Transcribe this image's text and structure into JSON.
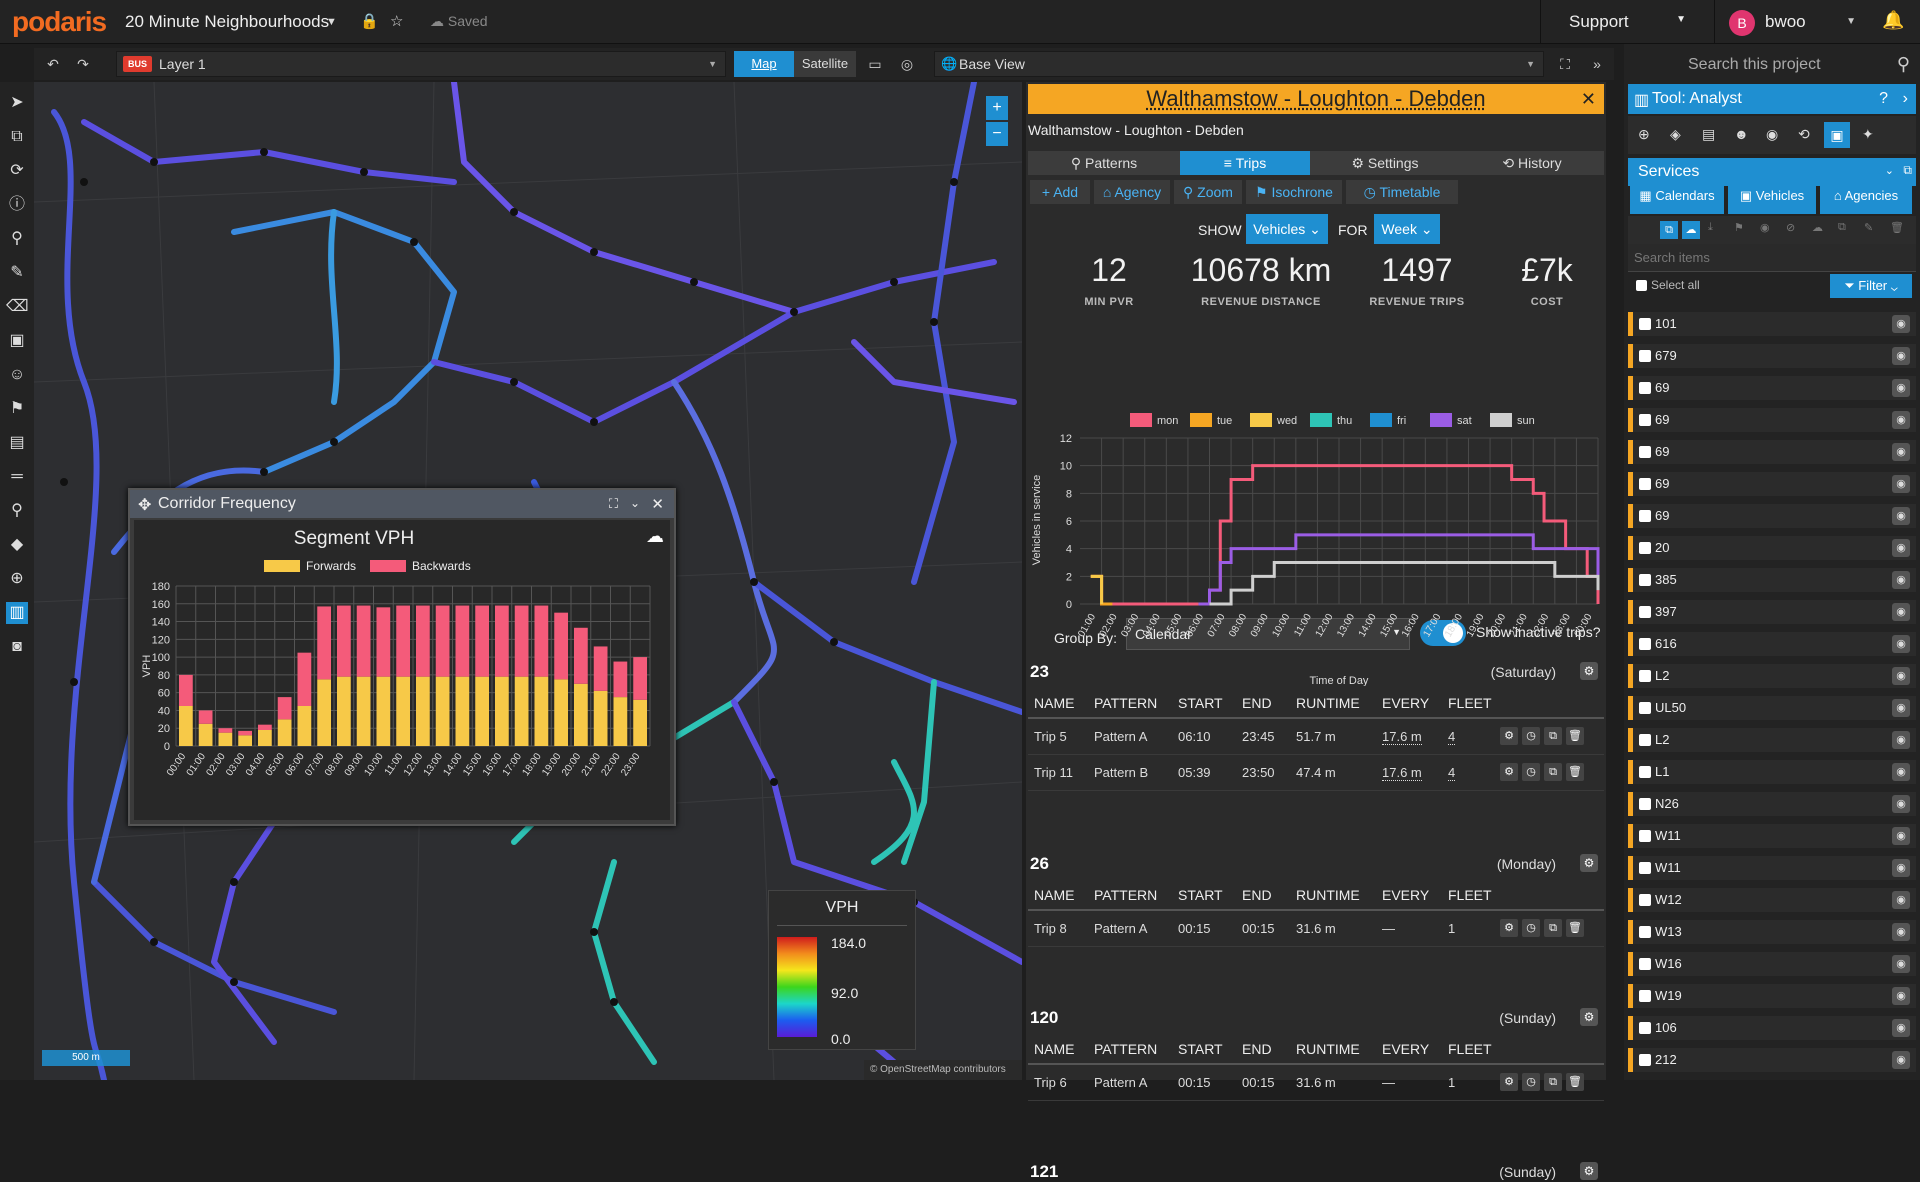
{
  "app": {
    "logo": "podaris",
    "project_title": "20 Minute Neighbourhoods",
    "saved": "Saved",
    "support": "Support",
    "user_initial": "B",
    "user_name": "bwoo"
  },
  "toolbar2": {
    "layer_badge": "BUS",
    "layer_name": "Layer 1",
    "map_btn": "Map",
    "satellite_btn": "Satellite",
    "base_view": "Base View"
  },
  "map": {
    "scale": "500 m",
    "attribution": "© OpenStreetMap contributors"
  },
  "corridor": {
    "window_title": "Corridor Frequency",
    "chart_data": {
      "type": "bar",
      "title": "Segment VPH",
      "ylabel": "VPH",
      "ylim": [
        0,
        180
      ],
      "yticks": [
        0,
        20,
        40,
        60,
        80,
        100,
        120,
        140,
        160,
        180
      ],
      "categories": [
        "00:00",
        "01:00",
        "02:00",
        "03:00",
        "04:00",
        "05:00",
        "06:00",
        "07:00",
        "08:00",
        "09:00",
        "10:00",
        "11:00",
        "12:00",
        "13:00",
        "14:00",
        "15:00",
        "16:00",
        "17:00",
        "18:00",
        "19:00",
        "20:00",
        "21:00",
        "22:00",
        "23:00"
      ],
      "series": [
        {
          "name": "Forwards",
          "color": "#f7c948",
          "values": [
            45,
            25,
            15,
            12,
            18,
            30,
            45,
            75,
            78,
            78,
            78,
            78,
            78,
            78,
            78,
            78,
            78,
            78,
            78,
            75,
            70,
            62,
            55,
            52
          ]
        },
        {
          "name": "Backwards",
          "color": "#f45b7a",
          "values": [
            35,
            15,
            5,
            5,
            6,
            25,
            60,
            82,
            80,
            80,
            78,
            80,
            80,
            80,
            80,
            80,
            80,
            80,
            80,
            75,
            63,
            50,
            40,
            48
          ]
        }
      ]
    }
  },
  "vph_legend": {
    "title": "VPH",
    "max": "184.0",
    "mid": "92.0",
    "min": "0.0"
  },
  "route": {
    "title": "Walthamstow - Loughton - Debden",
    "subtitle": "Walthamstow - Loughton - Debden",
    "tabs": [
      "Patterns",
      "Trips",
      "Settings",
      "History"
    ],
    "actions": [
      "Add",
      "Agency",
      "Zoom",
      "Isochrone",
      "Timetable"
    ],
    "show_label": "SHOW",
    "show_value": "Vehicles",
    "for_label": "FOR",
    "for_value": "Week",
    "stats": [
      {
        "value": "12",
        "label": "MIN PVR"
      },
      {
        "value": "10678 km",
        "label": "REVENUE DISTANCE"
      },
      {
        "value": "1497",
        "label": "REVENUE TRIPS"
      },
      {
        "value": "£7k",
        "label": "COST"
      }
    ],
    "chart_data": {
      "type": "line",
      "ylabel": "Vehicles in service",
      "xlabel": "Time of Day",
      "ylim": [
        0,
        12
      ],
      "yticks": [
        0,
        2,
        4,
        6,
        8,
        10,
        12
      ],
      "xticks": [
        "01:00",
        "02:00",
        "03:00",
        "04:00",
        "05:00",
        "06:00",
        "07:00",
        "08:00",
        "09:00",
        "10:00",
        "11:00",
        "12:00",
        "13:00",
        "14:00",
        "15:00",
        "16:00",
        "17:00",
        "18:00",
        "19:00",
        "20:00",
        "21:00",
        "22:00",
        "23:00",
        "00:00"
      ],
      "series": [
        {
          "name": "mon",
          "color": "#f45b7a",
          "x": [
            0.5,
            1,
            1.5,
            5.5,
            6,
            6.5,
            7,
            8,
            9,
            10,
            11,
            12,
            13,
            14,
            15,
            16,
            17,
            18,
            19,
            20,
            21,
            21.5,
            22,
            22.5,
            23,
            23.5,
            24
          ],
          "y": [
            2,
            0,
            0,
            0,
            1,
            6,
            9,
            10,
            10,
            10,
            10,
            10,
            10,
            10,
            10,
            10,
            10,
            10,
            10,
            9,
            8,
            6,
            6,
            4,
            4,
            2,
            0
          ]
        },
        {
          "name": "tue",
          "color": "#f5a623",
          "x": [
            0.5,
            1,
            1.5
          ],
          "y": [
            2,
            0,
            0
          ]
        },
        {
          "name": "wed",
          "color": "#f7c948",
          "x": [
            0.5,
            1
          ],
          "y": [
            2,
            0
          ]
        },
        {
          "name": "thu",
          "color": "#2ec4b6",
          "x": [
            5.5,
            6
          ],
          "y": [
            0,
            0
          ]
        },
        {
          "name": "fri",
          "color": "#1f8fd1",
          "x": [
            5.5,
            6
          ],
          "y": [
            0,
            0
          ]
        },
        {
          "name": "sat",
          "color": "#9b5de5",
          "x": [
            5.5,
            6,
            6.5,
            7,
            8,
            9,
            10,
            11,
            12,
            13,
            14,
            15,
            16,
            17,
            18,
            19,
            20,
            21,
            22,
            23,
            24
          ],
          "y": [
            0,
            1,
            3,
            4,
            4,
            4,
            5,
            5,
            5,
            5,
            5,
            5,
            5,
            5,
            5,
            5,
            5,
            4,
            4,
            4,
            2
          ]
        },
        {
          "name": "sun",
          "color": "#cfcfcf",
          "x": [
            6,
            7,
            8,
            9,
            10,
            11,
            12,
            13,
            14,
            15,
            16,
            17,
            18,
            19,
            20,
            21,
            22,
            23,
            24
          ],
          "y": [
            0,
            1,
            2,
            3,
            3,
            3,
            3,
            3,
            3,
            3,
            3,
            3,
            3,
            3,
            3,
            3,
            2,
            2,
            1
          ]
        }
      ]
    },
    "group_by_label": "Group By:",
    "group_by_value": "Calendar",
    "inactive_label": "Show inactive trips?",
    "table_headers": [
      "NAME",
      "PATTERN",
      "START",
      "END",
      "RUNTIME",
      "EVERY",
      "FLEET"
    ],
    "groups": [
      {
        "id": "23",
        "day": "(Saturday)",
        "rows": [
          [
            "Trip 5",
            "Pattern A",
            "06:10",
            "23:45",
            "51.7 m",
            "17.6 m",
            "4"
          ],
          [
            "Trip 11",
            "Pattern B",
            "05:39",
            "23:50",
            "47.4 m",
            "17.6 m",
            "4"
          ]
        ]
      },
      {
        "id": "26",
        "day": "(Monday)",
        "rows": [
          [
            "Trip 8",
            "Pattern A",
            "00:15",
            "00:15",
            "31.6 m",
            "—",
            "1"
          ]
        ]
      },
      {
        "id": "120",
        "day": "(Sunday)",
        "rows": [
          [
            "Trip 6",
            "Pattern A",
            "00:15",
            "00:15",
            "31.6 m",
            "—",
            "1"
          ]
        ]
      },
      {
        "id": "121",
        "day": "(Sunday)",
        "rows": []
      }
    ]
  },
  "sidebar": {
    "search_placeholder": "Search this project",
    "tool_title": "Tool: Analyst",
    "services_title": "Services",
    "buttons": [
      "Calendars",
      "Vehicles",
      "Agencies"
    ],
    "search_items": "Search items",
    "select_all": "Select all",
    "filter": "Filter",
    "items": [
      "101",
      "679",
      "69",
      "69",
      "69",
      "69",
      "69",
      "20",
      "385",
      "397",
      "616",
      "L2",
      "UL50",
      "L2",
      "L1",
      "N26",
      "W11",
      "W11",
      "W12",
      "W13",
      "W16",
      "W19",
      "106",
      "212"
    ]
  }
}
